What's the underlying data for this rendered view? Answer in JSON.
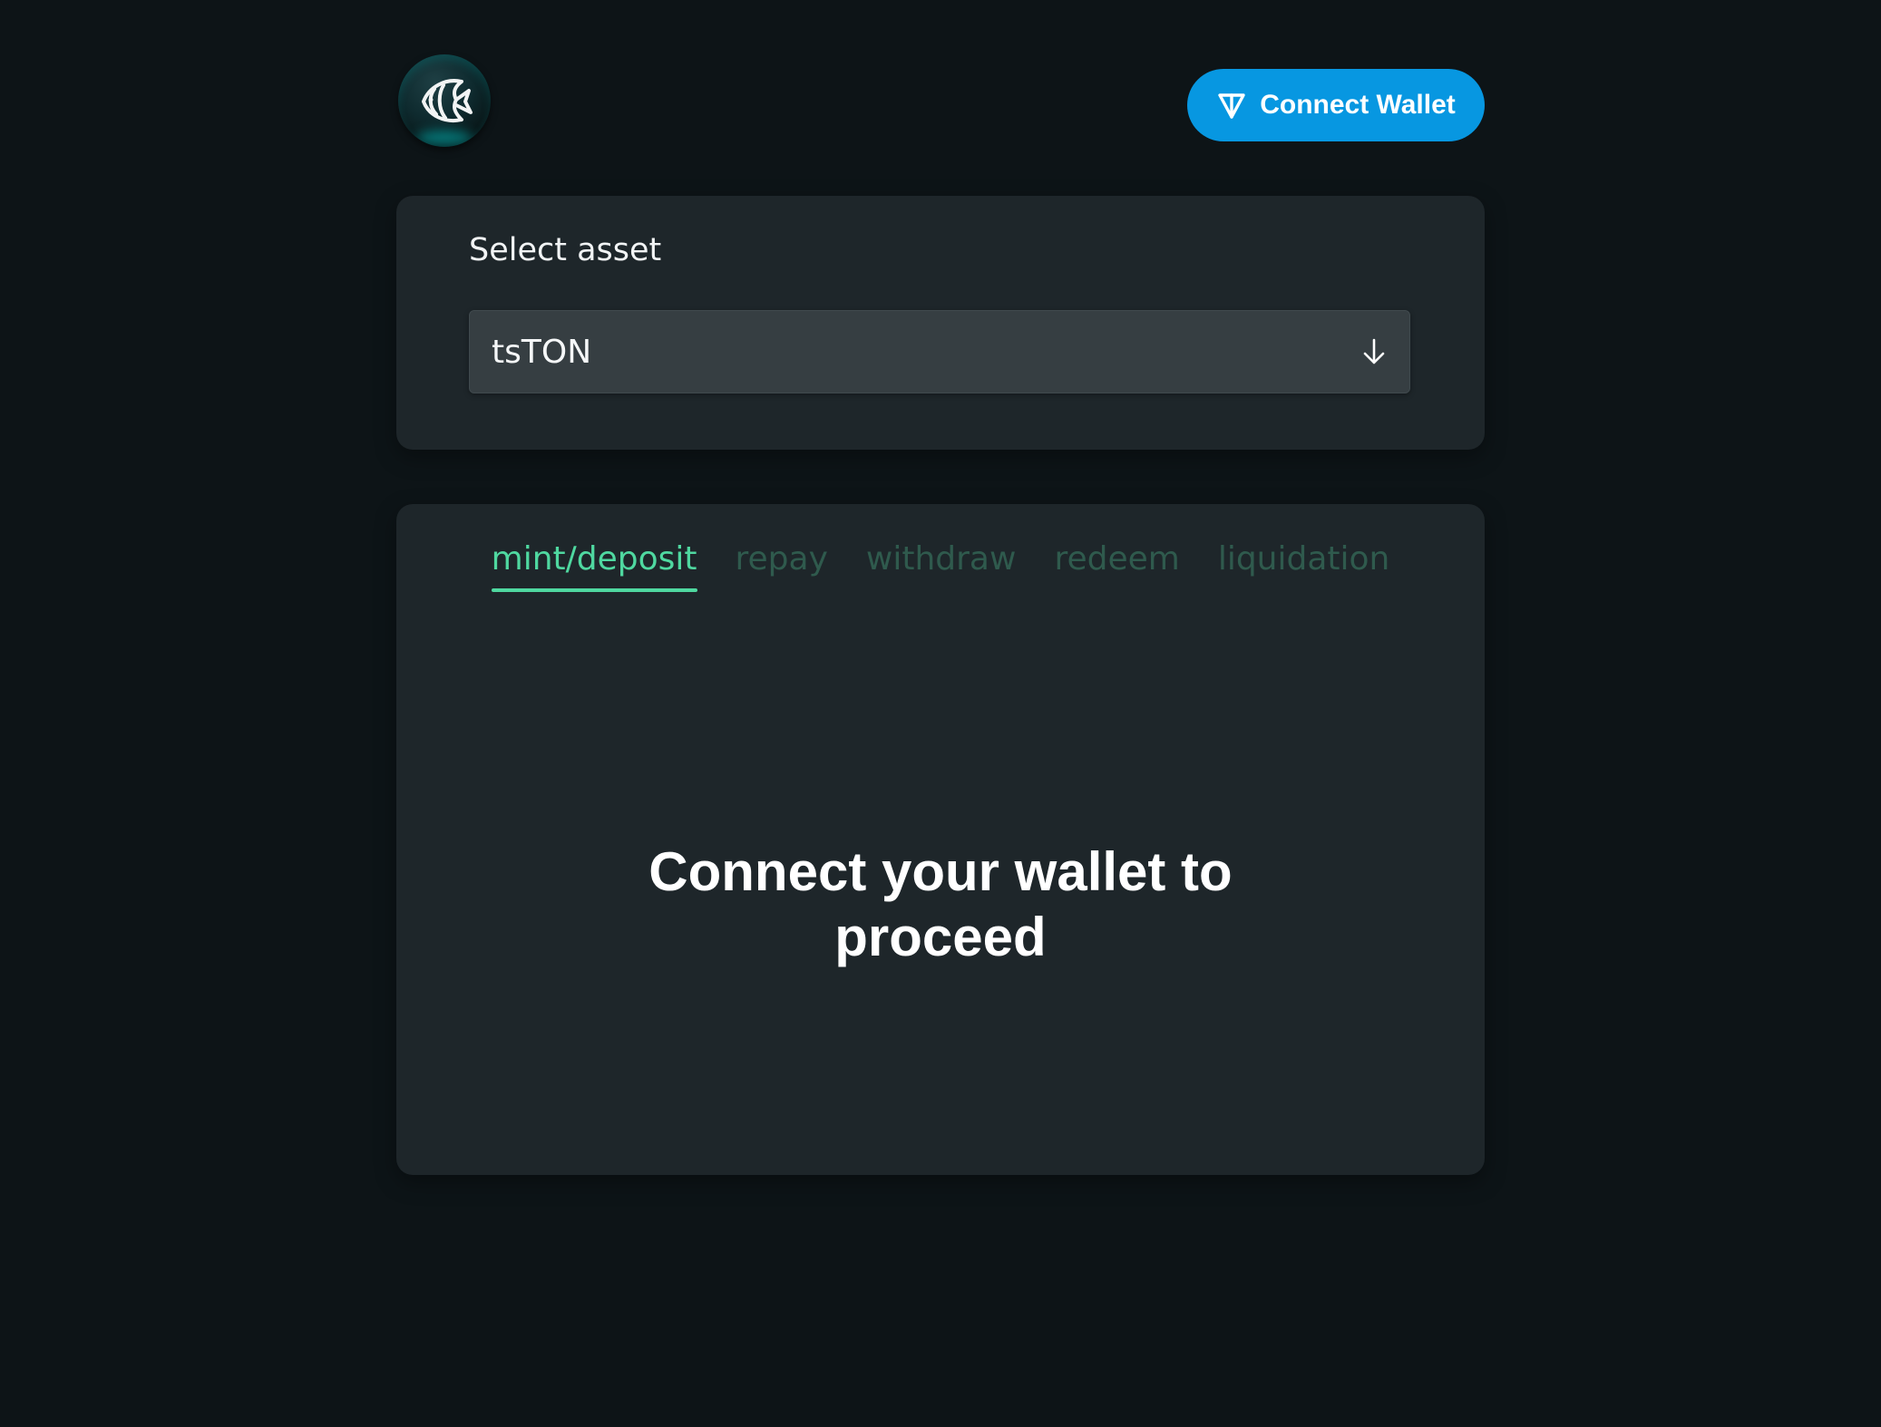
{
  "header": {
    "logo_icon": "fish-logo-icon",
    "connect_button": {
      "label": "Connect Wallet",
      "icon": "ton-diamond-icon",
      "color": "#0797e1"
    }
  },
  "asset_selector": {
    "label": "Select asset",
    "selected_value": "tsTON",
    "icon": "arrow-down-icon"
  },
  "actions": {
    "tabs": [
      {
        "label": "mint/deposit",
        "active": true
      },
      {
        "label": "repay",
        "active": false
      },
      {
        "label": "withdraw",
        "active": false
      },
      {
        "label": "redeem",
        "active": false
      },
      {
        "label": "liquidation",
        "active": false
      }
    ],
    "active_color": "#4fd8a0",
    "inactive_color": "#2f5a4d",
    "message": "Connect your wallet to proceed"
  }
}
